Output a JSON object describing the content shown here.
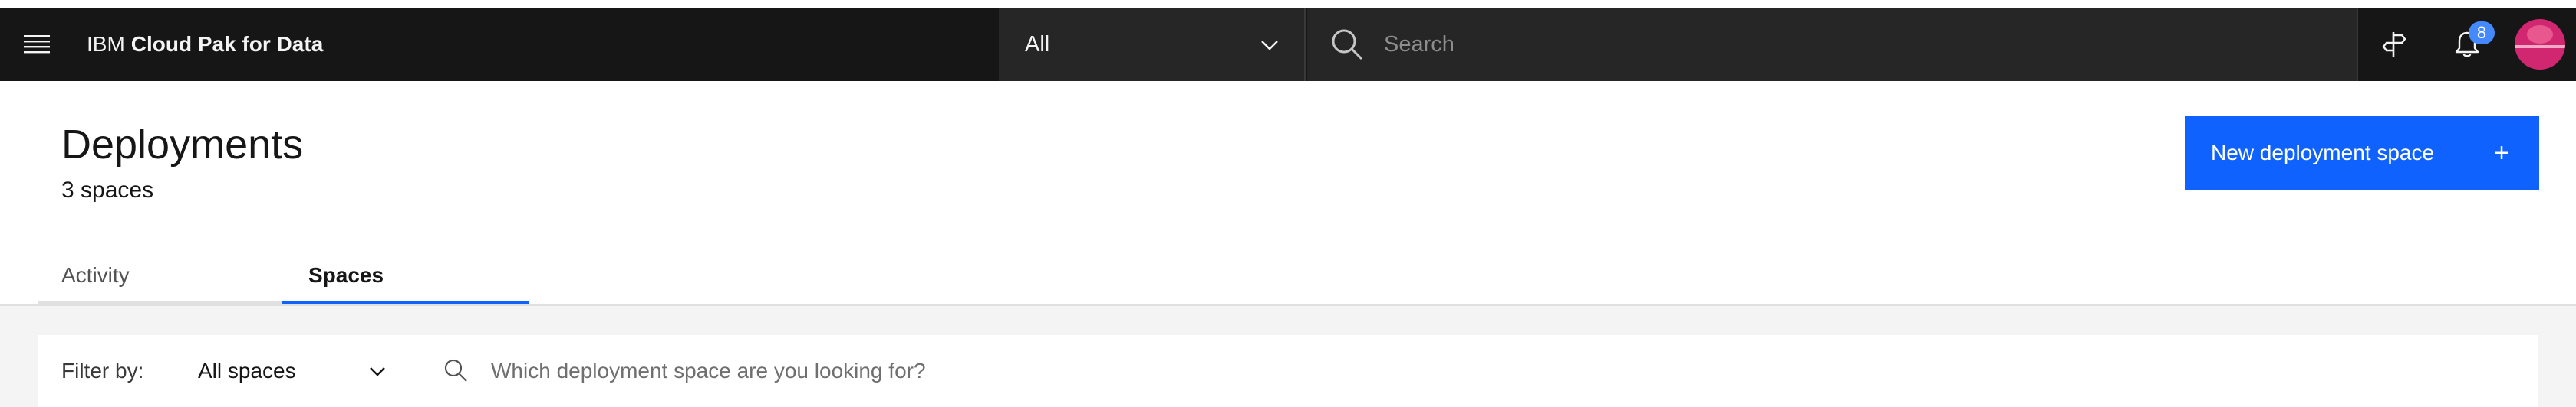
{
  "header": {
    "brand_prefix": "IBM",
    "brand_name": "Cloud Pak for Data",
    "scope_selected": "All",
    "search_placeholder": "Search",
    "notification_count": "8",
    "menu_icon": "hamburger-menu-icon",
    "help_icon": "signpost-icon",
    "notification_icon": "bell-icon",
    "avatar_color": "#d12771"
  },
  "page": {
    "title": "Deployments",
    "subtitle": "3 spaces",
    "primary_action_label": "New deployment space",
    "primary_action_icon": "+",
    "accent_color": "#0f62fe"
  },
  "tabs": [
    {
      "label": "Activity",
      "selected": false
    },
    {
      "label": "Spaces",
      "selected": true
    }
  ],
  "filter": {
    "label": "Filter by:",
    "selected": "All spaces",
    "search_placeholder": "Which deployment space are you looking for?"
  }
}
